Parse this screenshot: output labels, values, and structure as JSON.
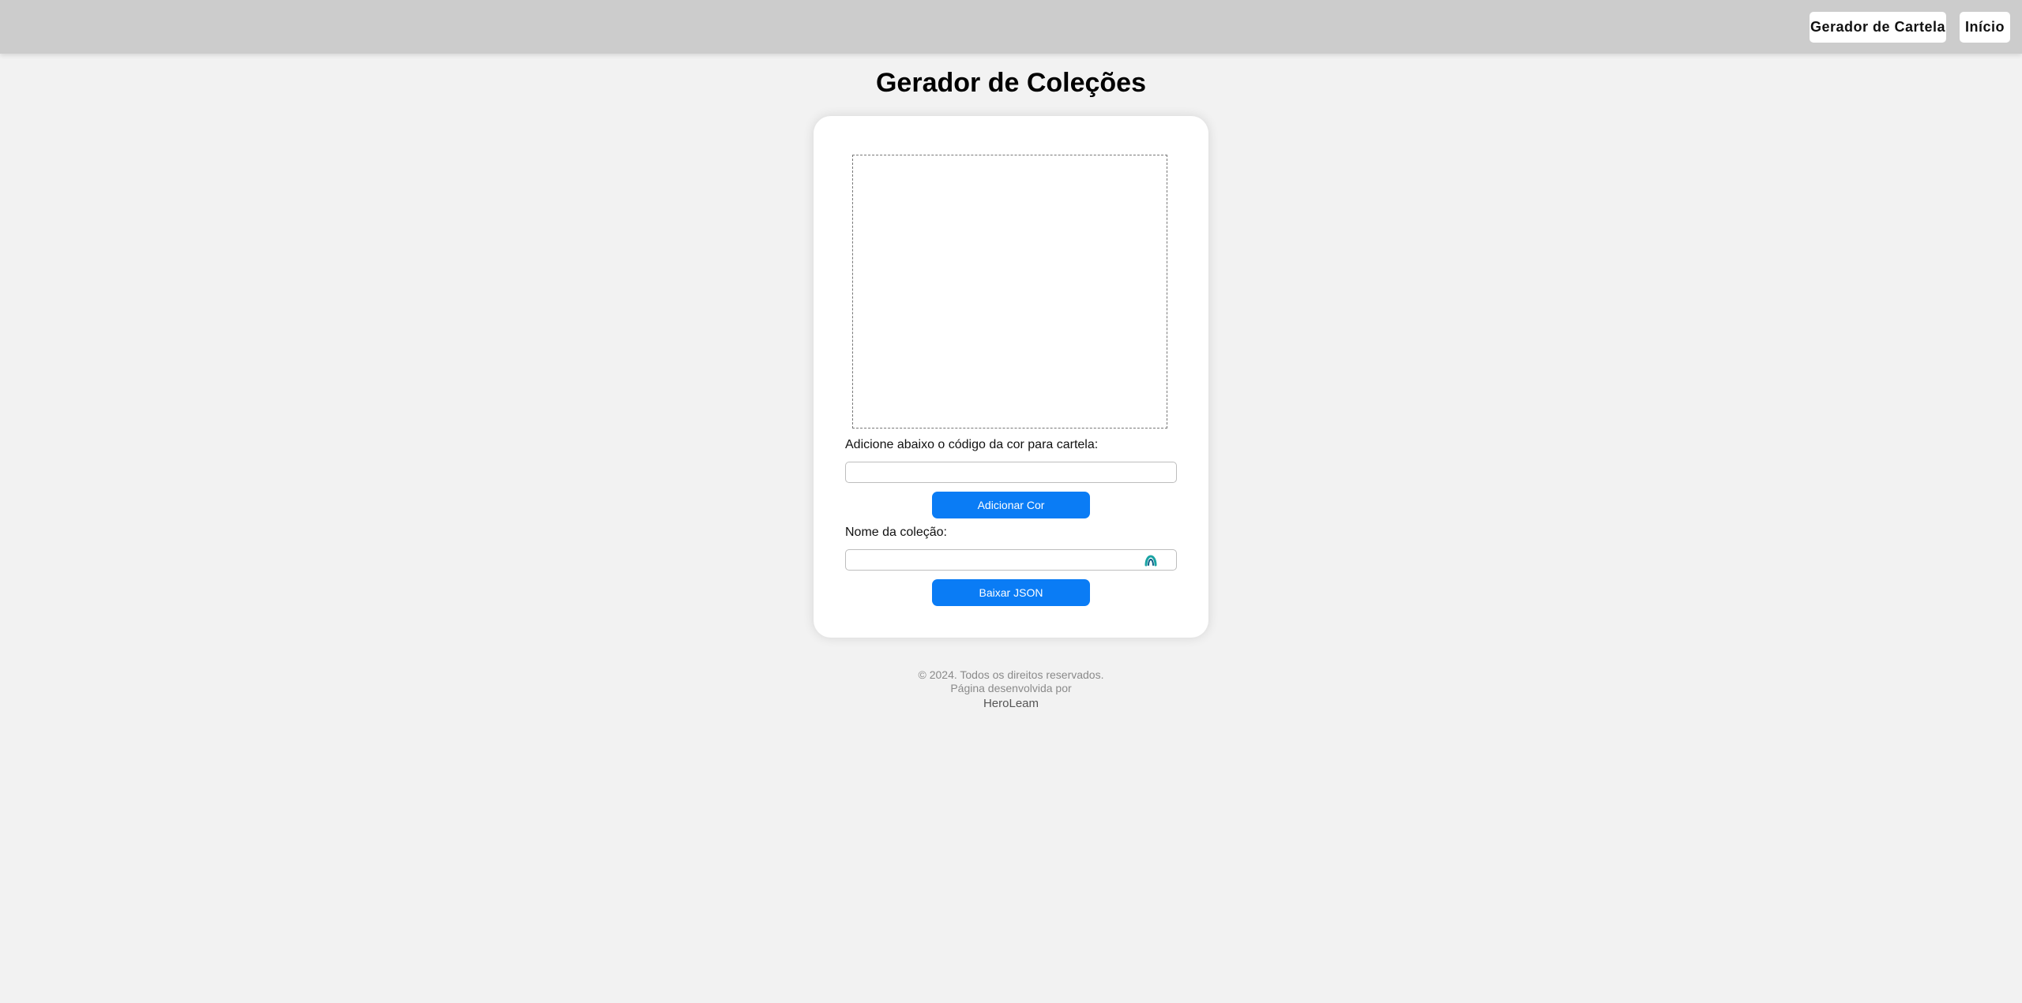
{
  "header": {
    "nav": {
      "cartela_label": "Gerador de Cartela",
      "inicio_label": "Início"
    }
  },
  "main": {
    "title": "Gerador de Coleções",
    "color_label": "Adicione abaixo o código da cor para cartela:",
    "color_input_value": "",
    "add_color_button": "Adicionar Cor",
    "collection_label": "Nome da coleção:",
    "collection_input_value": "",
    "download_button": "Baixar JSON"
  },
  "footer": {
    "copyright": "© 2024. Todos os direitos reservados.",
    "developed_by": "Página desenvolvida por",
    "developer": "HeroLeam"
  },
  "colors": {
    "header_bg": "#cccccc",
    "page_bg": "#f2f2f2",
    "accent_button": "#0a7cf5",
    "field_icon": "#1aa3a3"
  },
  "icons": {
    "field_icon": "autofill-icon"
  }
}
